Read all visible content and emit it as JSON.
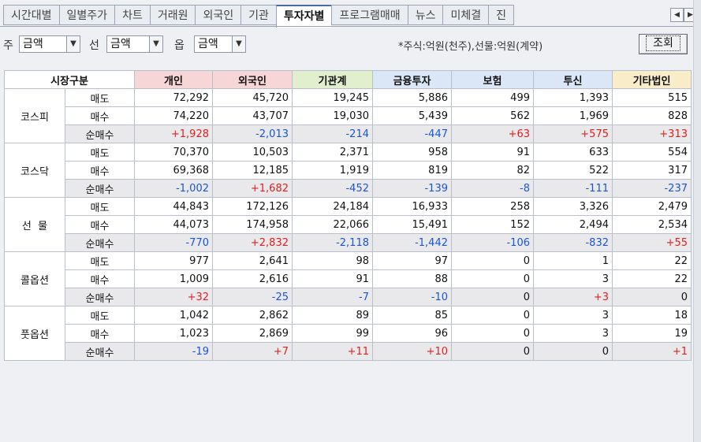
{
  "tabs": [
    "시간대별",
    "일별주가",
    "차트",
    "거래원",
    "외국인",
    "기관",
    "투자자별",
    "프로그램매매",
    "뉴스",
    "미체결",
    "진"
  ],
  "active_tab": 6,
  "tab_nav": {
    "prev_icon": "◀",
    "next_icon": "▶"
  },
  "toolbar": {
    "stock_label": "주",
    "stock_value": "금액",
    "futures_label": "선",
    "futures_value": "금액",
    "options_label": "옵",
    "options_value": "금액",
    "dropdown_glyph": "▼",
    "note": "*주식:억원(천주),선물:억원(계약)",
    "query_label": "조회"
  },
  "table": {
    "headers": [
      "시장구분",
      "개인",
      "외국인",
      "기관계",
      "금융투자",
      "보험",
      "투신",
      "기타법인"
    ],
    "header_colors": [
      "#ffffff",
      "#f6d6d6",
      "#f6d6d6",
      "#e2efcf",
      "#dbe7f7",
      "#dbe7f7",
      "#dbe7f7",
      "#f9ecc8"
    ],
    "markets": [
      {
        "name": "코스피",
        "rows": [
          {
            "label": "매도",
            "values": [
              "72,292",
              "45,720",
              "19,245",
              "5,886",
              "499",
              "1,393",
              "515"
            ]
          },
          {
            "label": "매수",
            "values": [
              "74,220",
              "43,707",
              "19,030",
              "5,439",
              "562",
              "1,969",
              "828"
            ]
          },
          {
            "label": "순매수",
            "values": [
              "+1,928",
              "-2,013",
              "-214",
              "-447",
              "+63",
              "+575",
              "+313"
            ]
          }
        ]
      },
      {
        "name": "코스닥",
        "rows": [
          {
            "label": "매도",
            "values": [
              "70,370",
              "10,503",
              "2,371",
              "958",
              "91",
              "633",
              "554"
            ]
          },
          {
            "label": "매수",
            "values": [
              "69,368",
              "12,185",
              "1,919",
              "819",
              "82",
              "522",
              "317"
            ]
          },
          {
            "label": "순매수",
            "values": [
              "-1,002",
              "+1,682",
              "-452",
              "-139",
              "-8",
              "-111",
              "-237"
            ]
          }
        ]
      },
      {
        "name": "선  물",
        "rows": [
          {
            "label": "매도",
            "values": [
              "44,843",
              "172,126",
              "24,184",
              "16,933",
              "258",
              "3,326",
              "2,479"
            ]
          },
          {
            "label": "매수",
            "values": [
              "44,073",
              "174,958",
              "22,066",
              "15,491",
              "152",
              "2,494",
              "2,534"
            ]
          },
          {
            "label": "순매수",
            "values": [
              "-770",
              "+2,832",
              "-2,118",
              "-1,442",
              "-106",
              "-832",
              "+55"
            ]
          }
        ]
      },
      {
        "name": "콜옵션",
        "rows": [
          {
            "label": "매도",
            "values": [
              "977",
              "2,641",
              "98",
              "97",
              "0",
              "1",
              "22"
            ]
          },
          {
            "label": "매수",
            "values": [
              "1,009",
              "2,616",
              "91",
              "88",
              "0",
              "3",
              "22"
            ]
          },
          {
            "label": "순매수",
            "values": [
              "+32",
              "-25",
              "-7",
              "-10",
              "0",
              "+3",
              "0"
            ]
          }
        ]
      },
      {
        "name": "풋옵션",
        "rows": [
          {
            "label": "매도",
            "values": [
              "1,042",
              "2,862",
              "89",
              "85",
              "0",
              "3",
              "18"
            ]
          },
          {
            "label": "매수",
            "values": [
              "1,023",
              "2,869",
              "99",
              "96",
              "0",
              "3",
              "19"
            ]
          },
          {
            "label": "순매수",
            "values": [
              "-19",
              "+7",
              "+11",
              "+10",
              "0",
              "0",
              "+1"
            ]
          }
        ]
      }
    ]
  },
  "colors": {
    "positive": "#e02020",
    "negative": "#1a55d0",
    "accent": "#4a6aa5"
  }
}
